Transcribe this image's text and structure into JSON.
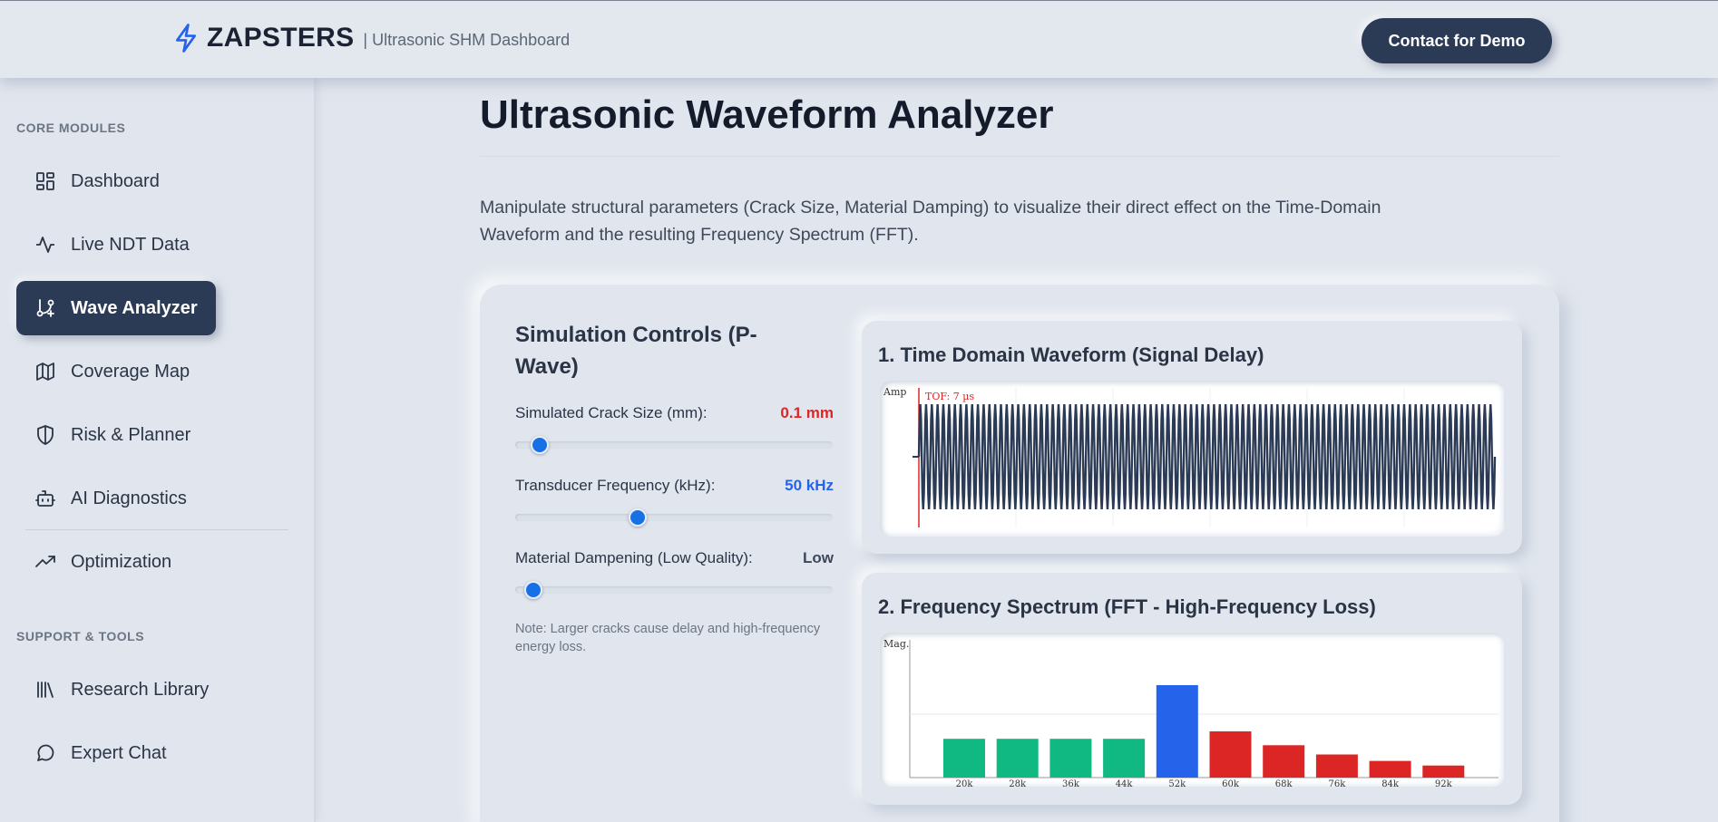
{
  "header": {
    "brand_name": "ZAPSTERS",
    "brand_sub": "| Ultrasonic SHM Dashboard",
    "demo_button": "Contact for Demo"
  },
  "sidebar": {
    "core_title": "CORE MODULES",
    "support_title": "SUPPORT & TOOLS",
    "items": [
      {
        "label": "Dashboard",
        "icon": "dashboard-icon"
      },
      {
        "label": "Live NDT Data",
        "icon": "activity-icon"
      },
      {
        "label": "Wave Analyzer",
        "icon": "git-branch-plus-icon",
        "active": true
      },
      {
        "label": "Coverage Map",
        "icon": "map-icon"
      },
      {
        "label": "Risk & Planner",
        "icon": "shield-icon"
      },
      {
        "label": "AI Diagnostics",
        "icon": "bot-icon"
      },
      {
        "label": "Optimization",
        "icon": "trending-up-icon"
      }
    ],
    "support_items": [
      {
        "label": "Research Library",
        "icon": "library-icon"
      },
      {
        "label": "Expert Chat",
        "icon": "chat-icon"
      }
    ]
  },
  "main": {
    "title": "Ultrasonic Waveform Analyzer",
    "description": "Manipulate structural parameters (Crack Size, Material Damping) to visualize their direct effect on the Time-Domain Waveform and the resulting Frequency Spectrum (FFT)."
  },
  "controls": {
    "title": "Simulation Controls (P-Wave)",
    "crack": {
      "label": "Simulated Crack Size (mm):",
      "value": "0.1 mm",
      "level": 0.05
    },
    "frequency": {
      "label": "Transducer Frequency (kHz):",
      "value": "50 kHz",
      "level": 0.38
    },
    "damping": {
      "label": "Material Dampening (Low Quality):",
      "value": "Low",
      "level": 0.03
    },
    "note": "Note: Larger cracks cause delay and high-frequency energy loss."
  },
  "colors": {
    "accent": "#2563eb",
    "danger": "#dc2626",
    "success": "#10b981",
    "wave": "#2b3a55"
  },
  "waveform": {
    "title": "1. Time Domain Waveform (Signal Delay)",
    "y_label": "Amp",
    "tof_label": "TOF: 7 µs",
    "cycles": 100
  },
  "chart_data": {
    "type": "bar",
    "title": "2. Frequency Spectrum (FFT - High-Frequency Loss)",
    "ylabel": "Mag.",
    "categories": [
      "20k",
      "28k",
      "36k",
      "44k",
      "52k",
      "60k",
      "68k",
      "76k",
      "84k",
      "92k"
    ],
    "values": [
      0.42,
      0.42,
      0.42,
      0.42,
      1.0,
      0.5,
      0.35,
      0.25,
      0.18,
      0.13
    ],
    "bar_colors": [
      "#10b981",
      "#10b981",
      "#10b981",
      "#10b981",
      "#2563eb",
      "#dc2626",
      "#dc2626",
      "#dc2626",
      "#dc2626",
      "#dc2626"
    ],
    "ylim": [
      0,
      1.0
    ],
    "grid": true
  }
}
